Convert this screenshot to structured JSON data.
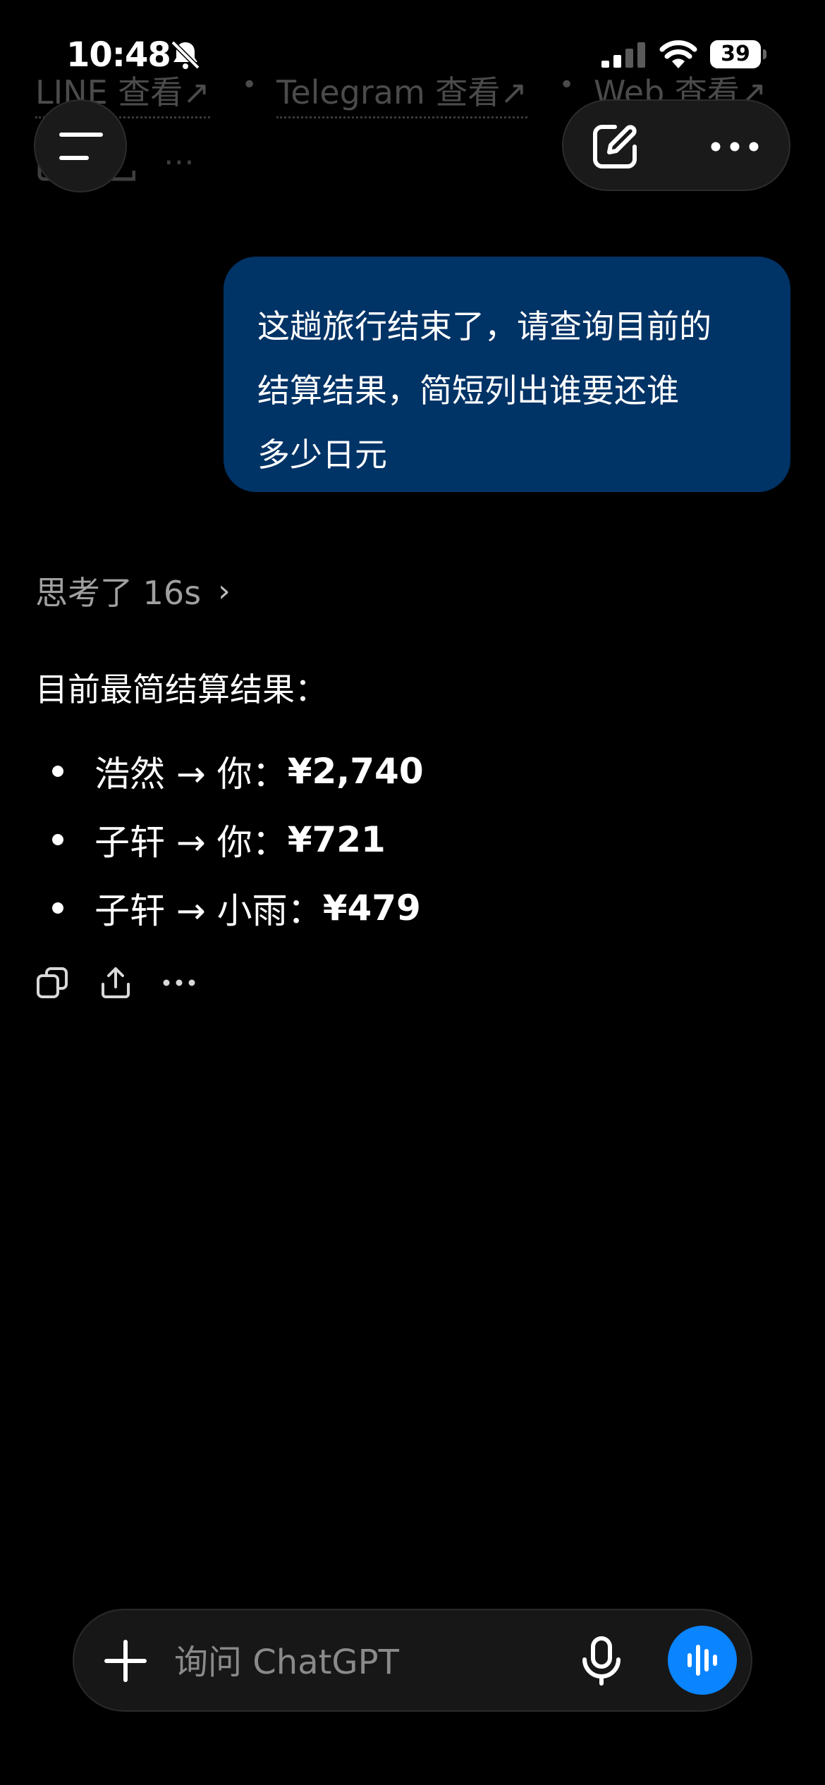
{
  "status_bar": {
    "time": "10:48",
    "battery": "39"
  },
  "previous_message": {
    "links": [
      "LINE 查看↗",
      "Telegram 查看↗",
      "Web 查看↗"
    ],
    "separator": "•"
  },
  "header": {
    "menu_icon": "hamburger-icon",
    "new_chat_icon": "edit-icon",
    "more_icon": "ellipsis-icon"
  },
  "user_message": {
    "lines": [
      "这趟旅行结束了，请查询目前的",
      "结算结果，简短列出谁要还谁",
      "多少日元"
    ]
  },
  "assistant": {
    "thinking_label": "思考了 16s",
    "thinking_chevron": "›",
    "intro": "目前最简结算结果：",
    "settlements": [
      {
        "text": "浩然 → 你：",
        "amount": "¥2,740"
      },
      {
        "text": "子轩 → 你：",
        "amount": "¥721"
      },
      {
        "text": "子轩 → 小雨：",
        "amount": "¥479"
      }
    ],
    "actions": [
      "copy-icon",
      "share-icon",
      "more-icon"
    ]
  },
  "composer": {
    "placeholder": "询问 ChatGPT"
  },
  "colors": {
    "background": "#000000",
    "user_bubble": "#003366",
    "voice_button": "#0a84ff"
  }
}
